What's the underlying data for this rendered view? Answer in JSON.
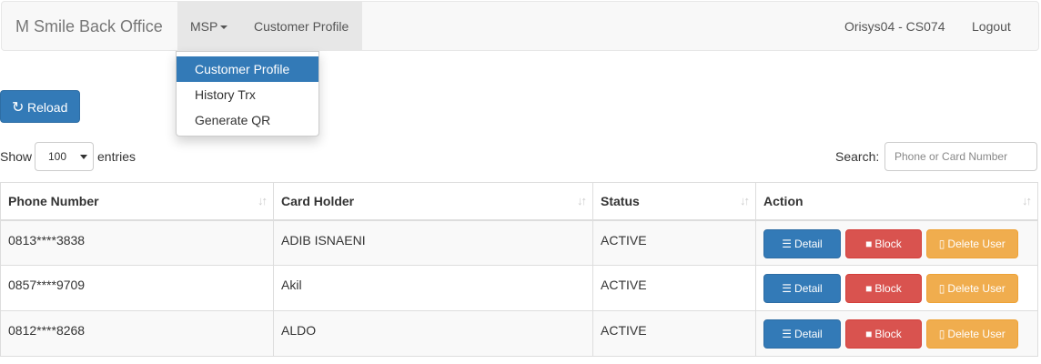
{
  "navbar": {
    "brand": "M Smile Back Office",
    "msp_label": "MSP",
    "customer_profile_label": "Customer Profile",
    "user": "Orisys04 - CS074",
    "logout_label": "Logout"
  },
  "dropdown": {
    "items": [
      {
        "label": "Customer Profile",
        "active": true
      },
      {
        "label": "History Trx",
        "active": false
      },
      {
        "label": "Generate QR",
        "active": false
      }
    ]
  },
  "reload_label": "Reload",
  "controls": {
    "show_label": "Show",
    "entries_value": "100",
    "entries_label": "entries",
    "search_label": "Search:",
    "search_placeholder": "Phone or Card Number"
  },
  "table": {
    "headers": [
      "Phone Number",
      "Card Holder",
      "Status",
      "Action"
    ],
    "rows": [
      {
        "phone": "0813****3838",
        "holder": "ADIB ISNAENI",
        "status": "ACTIVE"
      },
      {
        "phone": "0857****9709",
        "holder": "Akil",
        "status": "ACTIVE"
      },
      {
        "phone": "0812****8268",
        "holder": "ALDO",
        "status": "ACTIVE"
      }
    ],
    "actions": {
      "detail": "Detail",
      "block": "Block",
      "delete": "Delete User"
    }
  },
  "colors": {
    "primary": "#337ab7",
    "danger": "#d9534f",
    "warning": "#f0ad4e"
  },
  "icons": {
    "reload": "refresh-icon",
    "detail": "list-icon",
    "block": "lock-icon",
    "delete": "trash-icon",
    "sort": "sort-icon"
  }
}
